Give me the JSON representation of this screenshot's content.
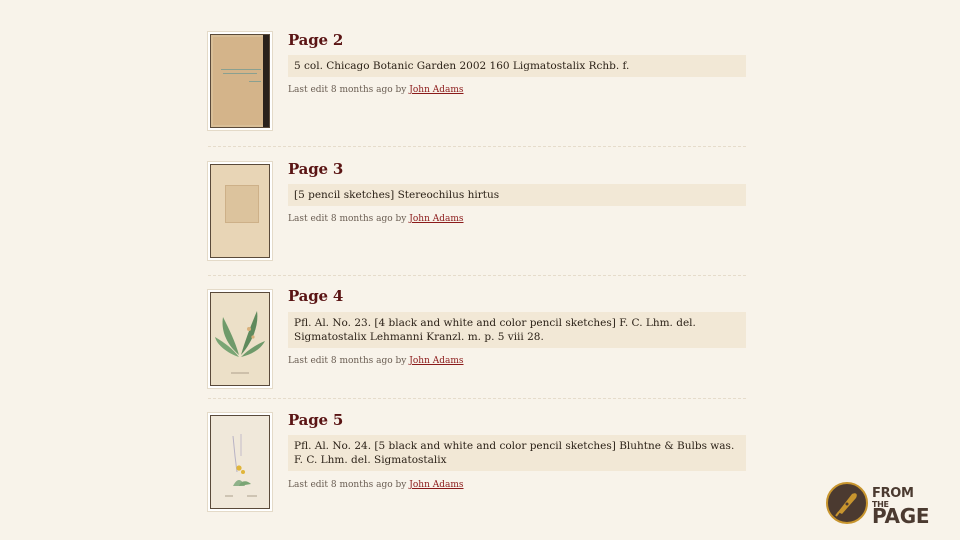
{
  "pages": [
    {
      "title": "Page 2",
      "description": "5 col. Chicago Botanic Garden 2002 160 Ligmatostalix Rchb. f.",
      "meta_prefix": "Last edit 8 months ago by",
      "author": "John Adams",
      "thumbnail": "scanned-folder-cover"
    },
    {
      "title": "Page 3",
      "description": "[5 pencil sketches] Stereochilus hirtus",
      "meta_prefix": "Last edit 8 months ago by",
      "author": "John Adams",
      "thumbnail": "pencil-sketch-sheet"
    },
    {
      "title": "Page 4",
      "description": "Pfl. Al. No. 23. [4 black and white and color pencil sketches] F. C. Lhm. del. Sigmatostalix Lehmanni Kranzl. m. p. 5 viii 28.",
      "meta_prefix": "Last edit 8 months ago by",
      "author": "John Adams",
      "thumbnail": "orchid-illustration"
    },
    {
      "title": "Page 5",
      "description": "Pfl. Al. No. 24. [5 black and white and color pencil sketches] Bluhtne & Bulbs was. F. C. Lhm. del. Sigmatostalix",
      "meta_prefix": "Last edit 8 months ago by",
      "author": "John Adams",
      "thumbnail": "orchid-sketch-yellow"
    }
  ],
  "logo": {
    "line1": "FROM",
    "line2": "THE",
    "line3": "PAGE",
    "icon": "quill-pen-icon"
  },
  "colors": {
    "background": "#f8f3ea",
    "title": "#5a1414",
    "link": "#8b1a1a",
    "description_bg": "#f2e8d6"
  }
}
